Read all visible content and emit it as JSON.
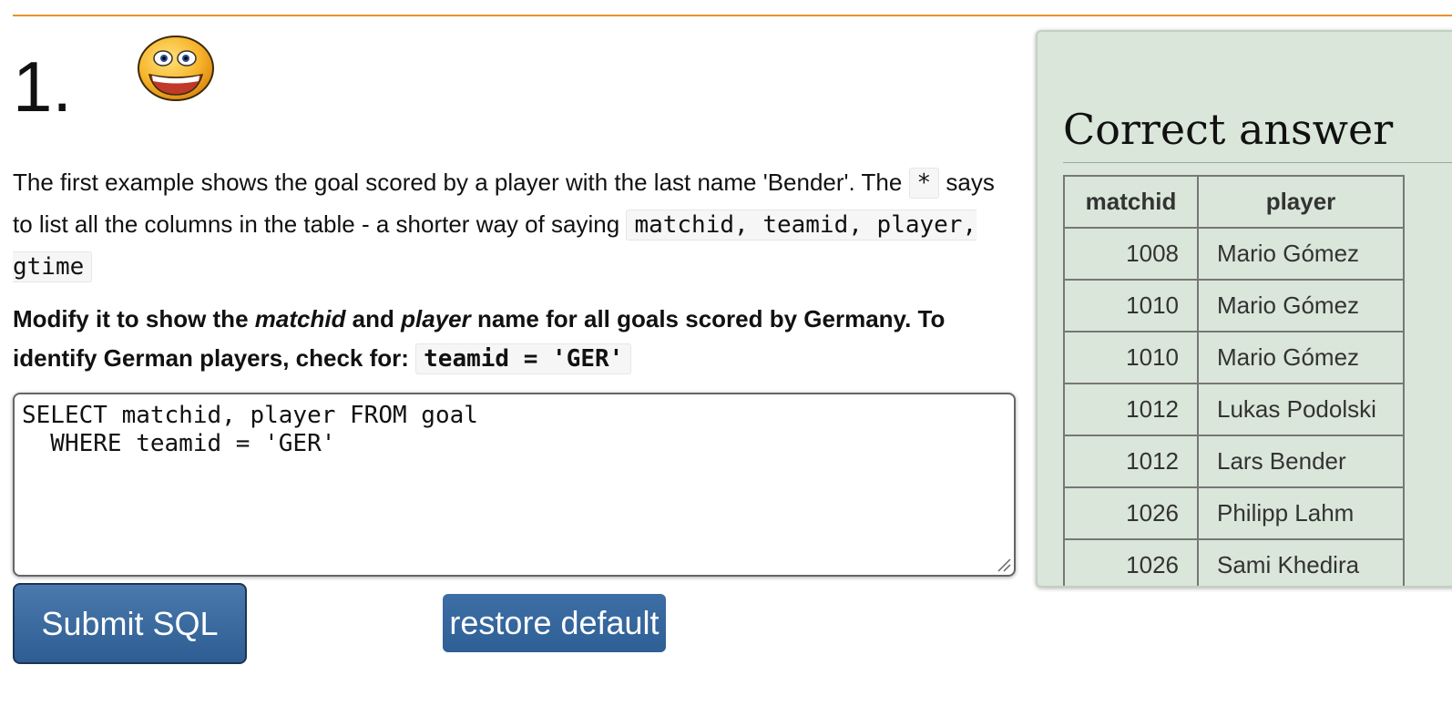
{
  "question": {
    "number": "1.",
    "icon": "smiley-face-icon"
  },
  "paragraph1": {
    "text_a": "The first example shows the goal scored by a player with the last name 'Bender'. The ",
    "code_star": "*",
    "text_b": " says to list all the columns in the table - a shorter way of saying ",
    "code_cols": "matchid, teamid, player, gtime"
  },
  "paragraph2": {
    "text_a": "Modify it to show the ",
    "em_matchid": "matchid",
    "text_b": " and ",
    "em_player": "player",
    "text_c": " name for all goals scored by Germany. To identify German players, check for: ",
    "code_teamid": "teamid = 'GER'"
  },
  "editor": {
    "sql": "SELECT matchid, player FROM goal\n  WHERE teamid = 'GER'"
  },
  "buttons": {
    "submit": "Submit SQL",
    "restore": "restore default"
  },
  "answer": {
    "title": "Correct answer",
    "columns": [
      "matchid",
      "player"
    ],
    "rows": [
      [
        "1008",
        "Mario Gómez"
      ],
      [
        "1010",
        "Mario Gómez"
      ],
      [
        "1010",
        "Mario Gómez"
      ],
      [
        "1012",
        "Lukas Podolski"
      ],
      [
        "1012",
        "Lars Bender"
      ],
      [
        "1026",
        "Philipp Lahm"
      ],
      [
        "1026",
        "Sami Khedira"
      ]
    ]
  },
  "colors": {
    "accent_rule": "#e8922e",
    "button_blue": "#2d5d92",
    "answer_bg": "#dae6d9"
  }
}
